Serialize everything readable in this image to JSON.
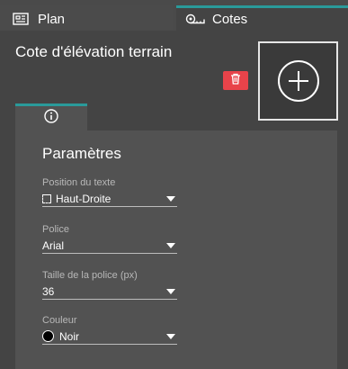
{
  "tabs": {
    "plan_label": "Plan",
    "cotes_label": "Cotes"
  },
  "header": {
    "title": "Cote d'élévation terrain"
  },
  "panel": {
    "title": "Paramètres",
    "fields": [
      {
        "label": "Position du texte",
        "value": "Haut-Droite"
      },
      {
        "label": "Police",
        "value": "Arial"
      },
      {
        "label": "Taille de la police (px)",
        "value": "36"
      },
      {
        "label": "Couleur",
        "value": "Noir"
      }
    ]
  },
  "colors": {
    "accent": "#2a9a9a",
    "delete": "#e8434a",
    "selected_color": "#000000"
  },
  "icons": [
    "plan-icon",
    "cotes-icon",
    "trash-icon",
    "add-icon",
    "info-icon",
    "chevron-down-icon"
  ]
}
